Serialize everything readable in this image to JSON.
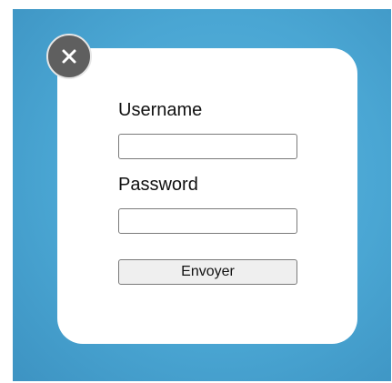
{
  "login_form": {
    "username_label": "Username",
    "username_value": "",
    "password_label": "Password",
    "password_value": "",
    "submit_label": "Envoyer"
  },
  "icons": {
    "close": "close-icon"
  },
  "colors": {
    "backdrop": "#4aa6d3",
    "dialog": "#ffffff",
    "close_button": "#5f5f5f"
  }
}
